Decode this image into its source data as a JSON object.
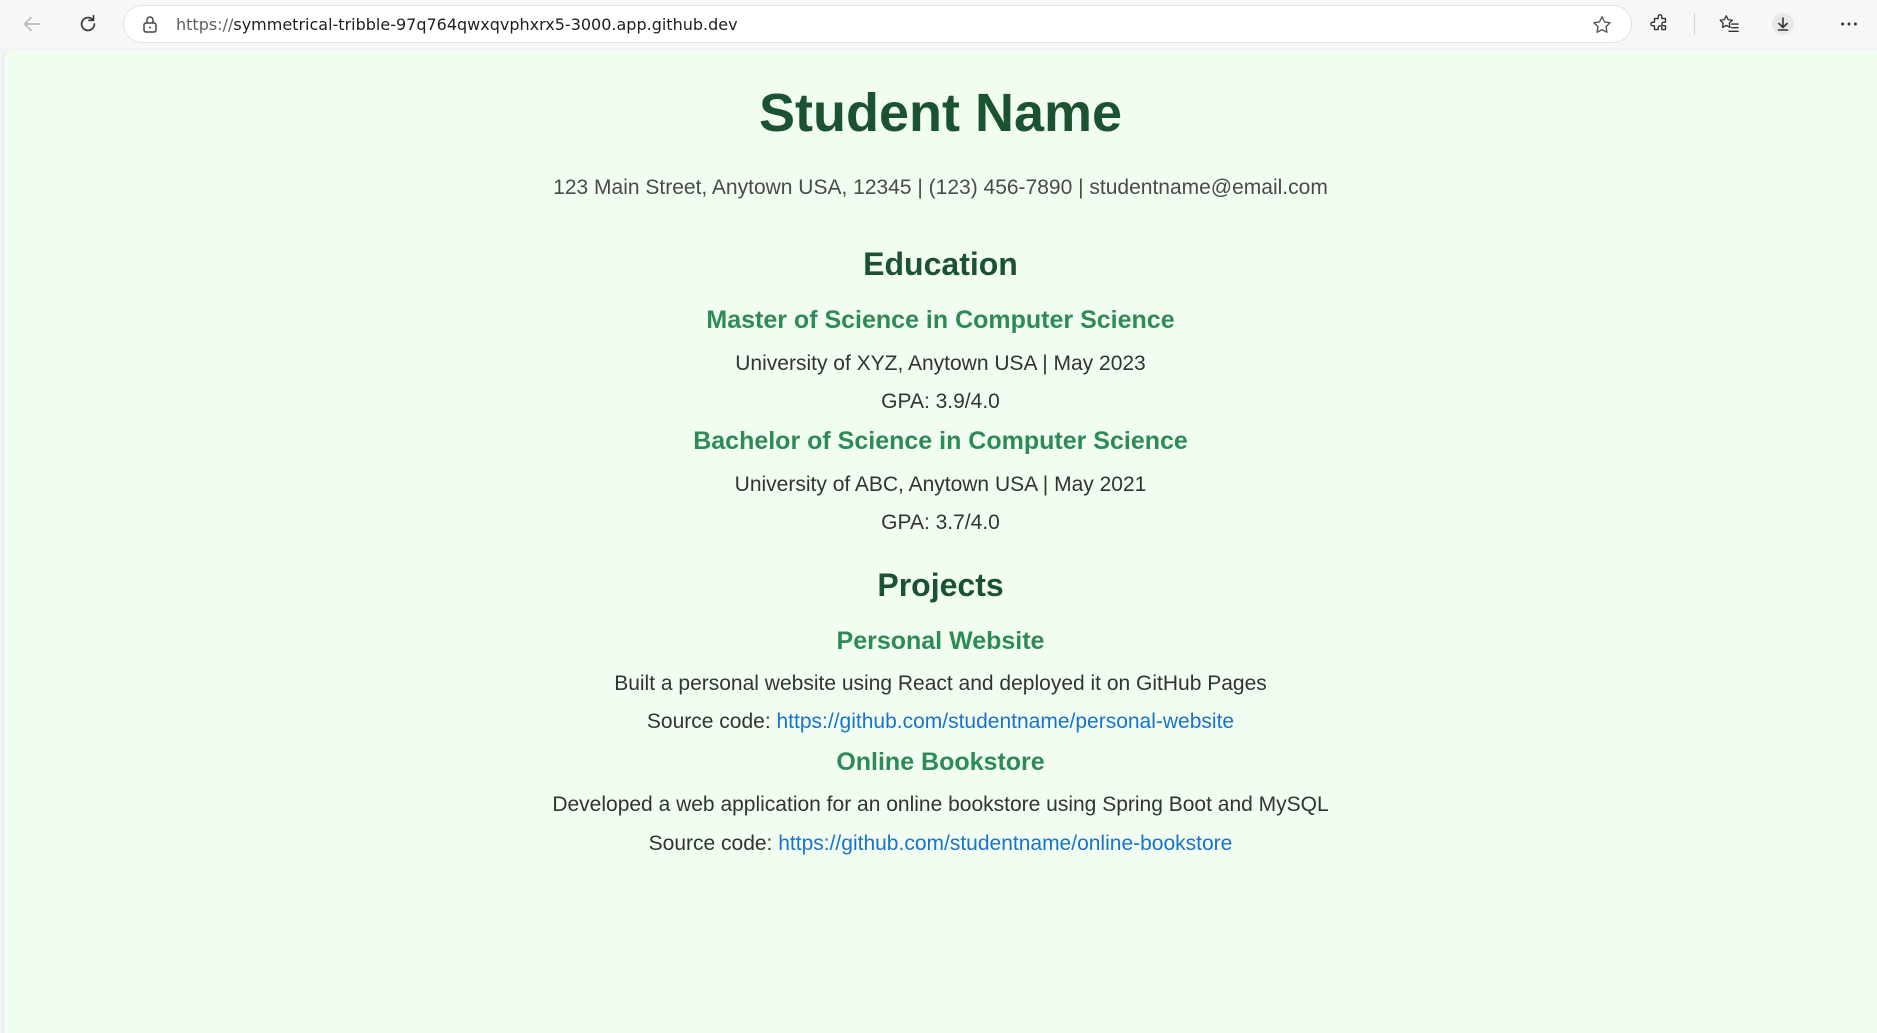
{
  "browser": {
    "url_scheme": "https://",
    "url_host": "symmetrical-tribble-97q764qwxqvphxrx5-3000.app.github.dev"
  },
  "icons": {
    "back": "back-arrow-icon",
    "reload": "reload-icon",
    "lock": "lock-icon",
    "favorite": "star-icon",
    "extensions": "puzzle-icon",
    "favorites": "favorites-list-icon",
    "downloads": "download-icon",
    "menu": "more-icon"
  },
  "colors": {
    "page_background": "#f1fdf0",
    "heading": "#1b5232",
    "subheading": "#2e8b57",
    "link": "#1a73c9"
  },
  "resume": {
    "name": "Student Name",
    "contact": "123 Main Street, Anytown USA, 12345 | (123) 456-7890 | studentname@email.com",
    "education": {
      "title": "Education",
      "items": [
        {
          "degree": "Master of Science in Computer Science",
          "school": "University of XYZ, Anytown USA | May 2023",
          "gpa": "GPA: 3.9/4.0"
        },
        {
          "degree": "Bachelor of Science in Computer Science",
          "school": "University of ABC, Anytown USA | May 2021",
          "gpa": "GPA: 3.7/4.0"
        }
      ]
    },
    "projects": {
      "title": "Projects",
      "items": [
        {
          "name": "Personal Website",
          "description": "Built a personal website using React and deployed it on GitHub Pages",
          "source_label": "Source code: ",
          "source_url": "https://github.com/studentname/personal-website"
        },
        {
          "name": "Online Bookstore",
          "description": "Developed a web application for an online bookstore using Spring Boot and MySQL",
          "source_label": "Source code: ",
          "source_url": "https://github.com/studentname/online-bookstore"
        }
      ]
    }
  }
}
